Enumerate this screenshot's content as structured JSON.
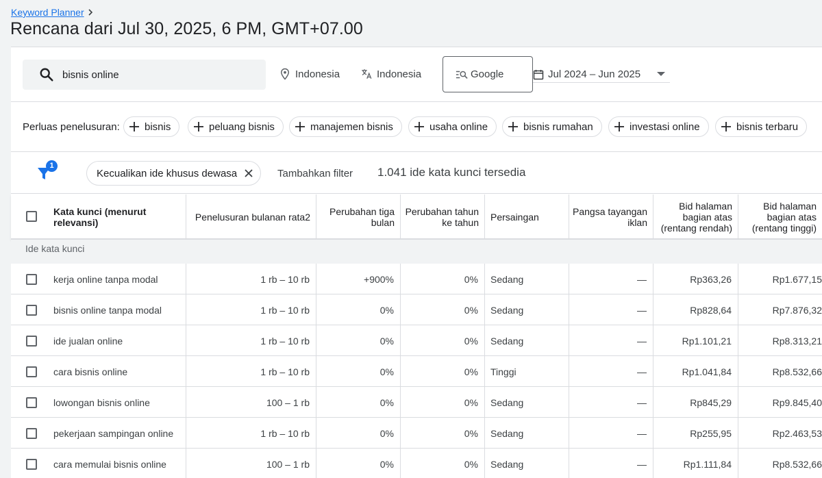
{
  "breadcrumb": {
    "label": "Keyword Planner"
  },
  "page_title": "Rencana dari Jul 30, 2025, 6 PM, GMT+07.00",
  "search": {
    "value": "bisnis online",
    "location": "Indonesia",
    "language": "Indonesia",
    "network": "Google",
    "date_range": "Jul 2024 – Jun 2025"
  },
  "broaden": {
    "label": "Perluas penelusuran:",
    "chips": [
      "bisnis",
      "peluang bisnis",
      "manajemen bisnis",
      "usaha online",
      "bisnis rumahan",
      "investasi online",
      "bisnis terbaru"
    ]
  },
  "filters": {
    "badge_count": "1",
    "active_filter": "Kecualikan ide khusus dewasa",
    "add_filter": "Tambahkan filter",
    "result_count": "1.041 ide kata kunci tersedia"
  },
  "table": {
    "headers": {
      "keyword": "Kata kunci (menurut relevansi)",
      "avg_searches": "Penelusuran bulanan rata2",
      "three_month": "Perubahan tiga bulan",
      "yoy": "Perubahan tahun ke tahun",
      "competition": "Persaingan",
      "impression_share": "Pangsa tayangan iklan",
      "bid_low": "Bid halaman bagian atas (rentang rendah)",
      "bid_high": "Bid halaman bagian atas (rentang tinggi)"
    },
    "group_label": "Ide kata kunci",
    "rows": [
      {
        "keyword": "kerja online tanpa modal",
        "avg": "1 rb – 10 rb",
        "three": "+900%",
        "yoy": "0%",
        "comp": "Sedang",
        "share": "—",
        "low": "Rp363,26",
        "high": "Rp1.677,15"
      },
      {
        "keyword": "bisnis online tanpa modal",
        "avg": "1 rb – 10 rb",
        "three": "0%",
        "yoy": "0%",
        "comp": "Sedang",
        "share": "—",
        "low": "Rp828,64",
        "high": "Rp7.876,32"
      },
      {
        "keyword": "ide jualan online",
        "avg": "1 rb – 10 rb",
        "three": "0%",
        "yoy": "0%",
        "comp": "Sedang",
        "share": "—",
        "low": "Rp1.101,21",
        "high": "Rp8.313,21"
      },
      {
        "keyword": "cara bisnis online",
        "avg": "1 rb – 10 rb",
        "three": "0%",
        "yoy": "0%",
        "comp": "Tinggi",
        "share": "—",
        "low": "Rp1.041,84",
        "high": "Rp8.532,66"
      },
      {
        "keyword": "lowongan bisnis online",
        "avg": "100 – 1 rb",
        "three": "0%",
        "yoy": "0%",
        "comp": "Sedang",
        "share": "—",
        "low": "Rp845,29",
        "high": "Rp9.845,40"
      },
      {
        "keyword": "pekerjaan sampingan online",
        "avg": "1 rb – 10 rb",
        "three": "0%",
        "yoy": "0%",
        "comp": "Sedang",
        "share": "—",
        "low": "Rp255,95",
        "high": "Rp2.463,53"
      },
      {
        "keyword": "cara memulai bisnis online",
        "avg": "100 – 1 rb",
        "three": "0%",
        "yoy": "0%",
        "comp": "Sedang",
        "share": "—",
        "low": "Rp1.111,84",
        "high": "Rp8.532,66"
      }
    ]
  },
  "colors": {
    "accent": "#1a73e8",
    "text": "#202124",
    "border": "#dadce0",
    "background": "#f1f3f4"
  }
}
